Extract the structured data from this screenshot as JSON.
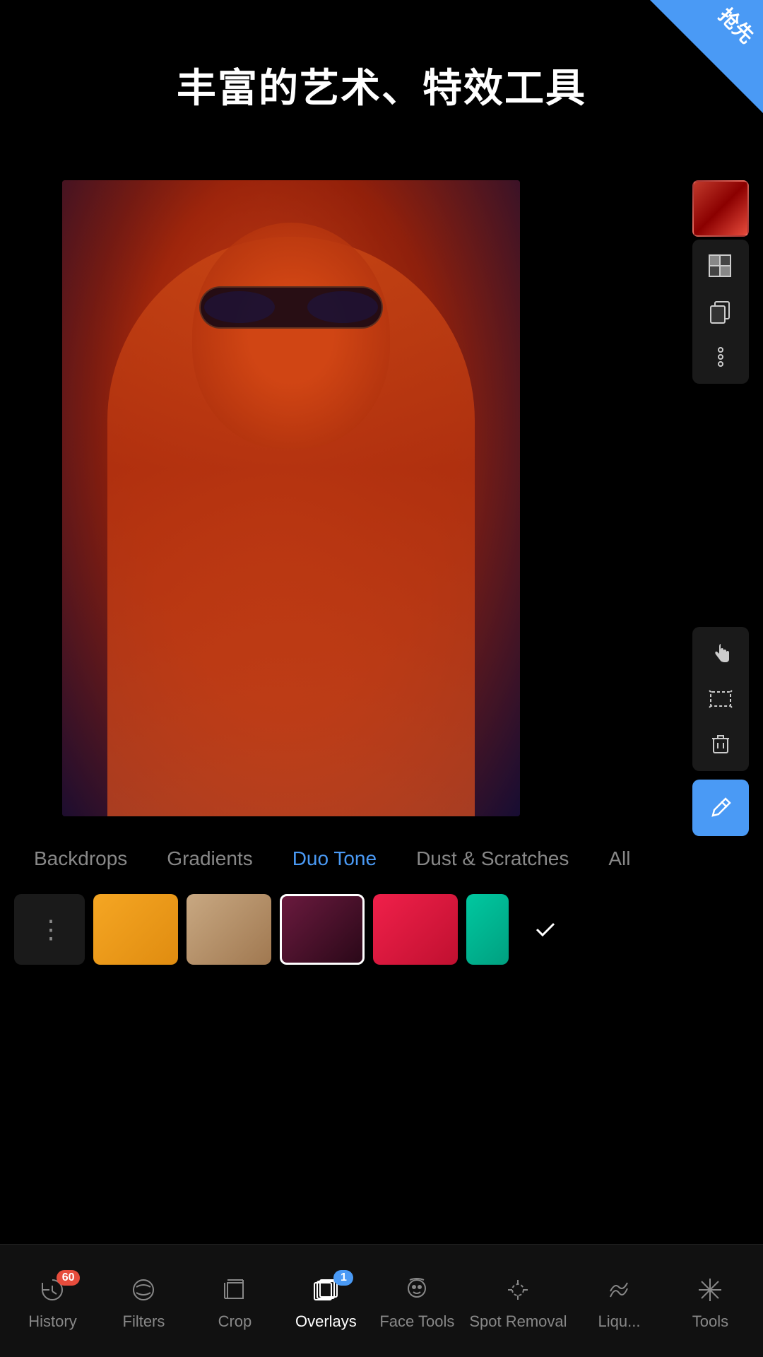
{
  "banner": {
    "text": "抢先"
  },
  "title": "丰富的艺术、特效工具",
  "right_toolbar": {
    "icons": [
      "checkerboard",
      "duplicate",
      "more"
    ]
  },
  "categories": [
    {
      "label": "Backdrops",
      "active": false
    },
    {
      "label": "Gradients",
      "active": false
    },
    {
      "label": "Duo Tone",
      "active": true
    },
    {
      "label": "Dust & Scratches",
      "active": false
    },
    {
      "label": "All",
      "active": false
    }
  ],
  "swatches": [
    {
      "id": "more",
      "type": "more"
    },
    {
      "id": "orange",
      "color": "#f5a623",
      "selected": false
    },
    {
      "id": "tan",
      "color": "#c8a882",
      "selected": false
    },
    {
      "id": "dark-red",
      "color": "#4a1a2e",
      "selected": true
    },
    {
      "id": "hot-pink",
      "color": "#f0204a",
      "selected": false
    },
    {
      "id": "teal-partial",
      "color": "#00c8a0",
      "selected": false
    }
  ],
  "bottom_nav": [
    {
      "id": "history",
      "label": "History",
      "icon": "history",
      "badge": "60",
      "active": false
    },
    {
      "id": "filters",
      "label": "Filters",
      "icon": "filters",
      "badge": null,
      "active": false
    },
    {
      "id": "crop",
      "label": "Crop",
      "icon": "crop",
      "badge": null,
      "active": false
    },
    {
      "id": "overlays",
      "label": "Overlays",
      "icon": "overlays",
      "badge": "1",
      "active": true
    },
    {
      "id": "face-tools",
      "label": "Face Tools",
      "icon": "face",
      "badge": null,
      "active": false
    },
    {
      "id": "spot-removal",
      "label": "Spot Removal",
      "icon": "spot",
      "badge": null,
      "active": false
    },
    {
      "id": "liquify",
      "label": "Liqu...",
      "icon": "liquify",
      "badge": null,
      "active": false
    },
    {
      "id": "tools",
      "label": "Tools",
      "icon": "tools",
      "badge": null,
      "active": false
    }
  ]
}
